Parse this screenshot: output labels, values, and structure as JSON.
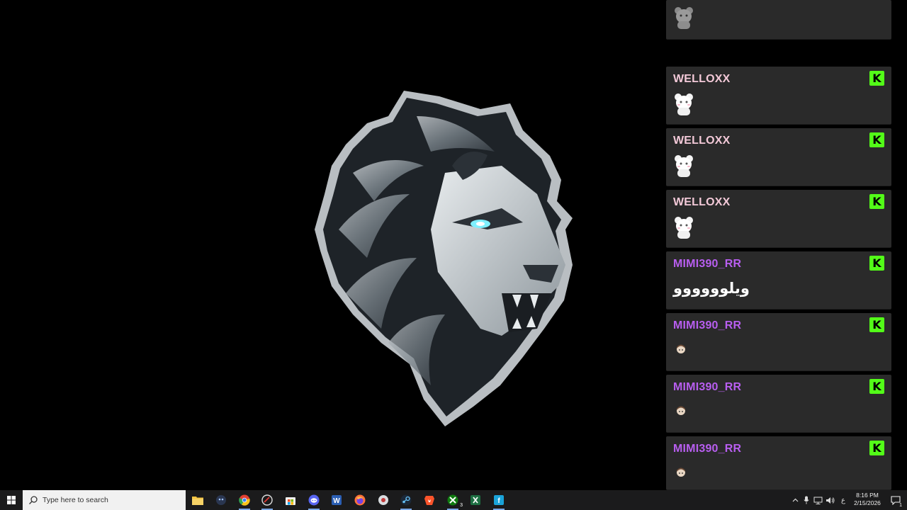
{
  "chat": {
    "partial_top": {
      "emote": "bear-emote"
    },
    "messages": [
      {
        "username": "WELLOXX",
        "color": "#f3c9d8",
        "badge": "K",
        "content_type": "emote",
        "emote": "white-bear-emote"
      },
      {
        "username": "WELLOXX",
        "color": "#f3c9d8",
        "badge": "K",
        "content_type": "emote",
        "emote": "white-bear-emote"
      },
      {
        "username": "WELLOXX",
        "color": "#f3c9d8",
        "badge": "K",
        "content_type": "emote",
        "emote": "white-bear-emote"
      },
      {
        "username": "MIMI390_RR",
        "color": "#b85ef0",
        "badge": "K",
        "content_type": "text",
        "text": "ويلوووووو"
      },
      {
        "username": "MIMI390_RR",
        "color": "#b85ef0",
        "badge": "K",
        "content_type": "emote",
        "emote": "small-face-emote"
      },
      {
        "username": "MIMI390_RR",
        "color": "#b85ef0",
        "badge": "K",
        "content_type": "emote",
        "emote": "small-face-emote"
      },
      {
        "username": "MIMI390_RR",
        "color": "#b85ef0",
        "badge": "K",
        "content_type": "emote",
        "emote": "small-face-emote"
      }
    ]
  },
  "taskbar": {
    "search_placeholder": "Type here to search",
    "apps": [
      "file-explorer-icon",
      "app-icon",
      "chrome-icon",
      "app-icon",
      "store-icon",
      "discord-icon",
      "word-icon",
      "firefox-icon",
      "app-icon",
      "steam-icon",
      "brave-icon",
      "xbox-icon",
      "excel-icon",
      "app-icon"
    ],
    "xbox_badge": "3",
    "language": "ع",
    "time": "8:16 PM",
    "date": "2/15/2026",
    "notification_count": "1"
  },
  "colors": {
    "kick_green": "#53fc18",
    "taskbar_bg": "#1b1b1c",
    "chat_bg": "#2a2a2a"
  }
}
